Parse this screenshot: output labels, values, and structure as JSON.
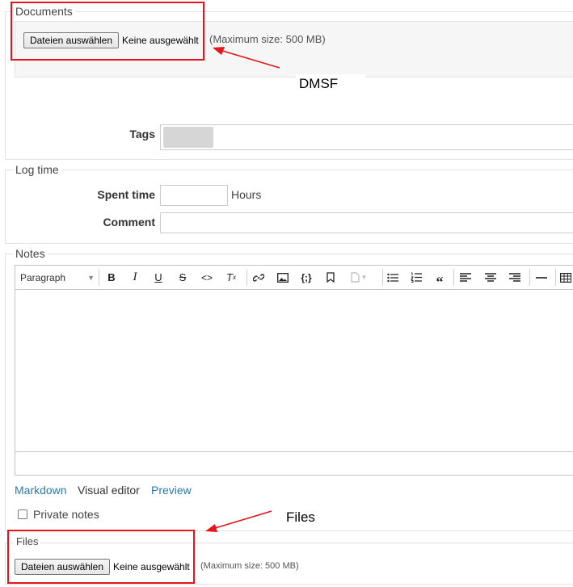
{
  "documents": {
    "legend": "Documents",
    "file_button": "Dateien auswählen",
    "no_file": "Keine ausgewählt",
    "max_size": "(Maximum size: 500 MB)",
    "tags_label": "Tags"
  },
  "log_time": {
    "legend": "Log time",
    "spent_time_label": "Spent time",
    "hours_suffix": "Hours",
    "spent_time_value": "",
    "comment_label": "Comment",
    "comment_value": ""
  },
  "notes": {
    "legend": "Notes",
    "format_select": "Paragraph",
    "toolbar_icons": [
      "bold-icon",
      "italic-icon",
      "underline-icon",
      "strikethrough-icon",
      "code-icon",
      "clear-format-icon",
      "link-icon",
      "image-icon",
      "code-block-icon",
      "bookmark-icon",
      "document-icon",
      "bullet-list-icon",
      "numbered-list-icon",
      "blockquote-icon",
      "align-left-icon",
      "align-center-icon",
      "align-right-icon",
      "horizontal-rule-icon",
      "table-icon"
    ],
    "tabs": {
      "markdown": "Markdown",
      "visual_editor": "Visual editor",
      "preview": "Preview"
    },
    "private_notes_label": "Private notes",
    "private_notes_checked": false
  },
  "files": {
    "legend": "Files",
    "file_button": "Dateien auswählen",
    "no_file": "Keine ausgewählt",
    "max_size": "(Maximum size: 500 MB)"
  },
  "annotations": {
    "dmsf_label": "DMSF",
    "files_label": "Files",
    "highlight_color": "#e8141b"
  }
}
